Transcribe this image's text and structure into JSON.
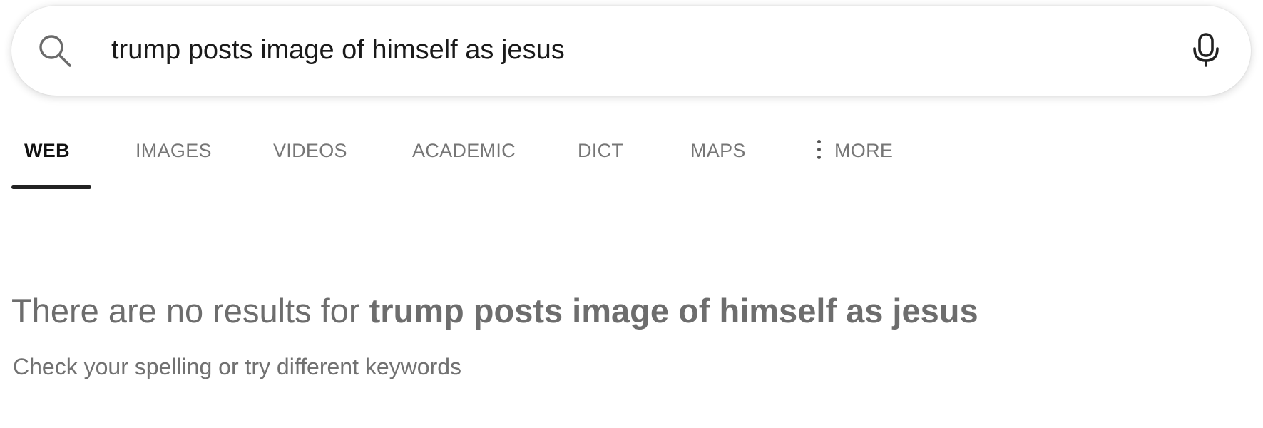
{
  "search": {
    "query": "trump posts image of himself as jesus",
    "search_icon": "search-icon",
    "mic_icon": "microphone-icon"
  },
  "tabs": [
    {
      "label": "WEB",
      "active": true
    },
    {
      "label": "IMAGES",
      "active": false
    },
    {
      "label": "VIDEOS",
      "active": false
    },
    {
      "label": "ACADEMIC",
      "active": false
    },
    {
      "label": "DICT",
      "active": false
    },
    {
      "label": "MAPS",
      "active": false
    },
    {
      "label": "MORE",
      "active": false,
      "icon": "kebab-menu-icon"
    }
  ],
  "results": {
    "no_results_prefix": "There are no results for ",
    "no_results_query": "trump posts image of himself as jesus",
    "hint": "Check your spelling or try different keywords"
  },
  "colors": {
    "active_tab": "#111111",
    "inactive_tab": "#767676",
    "muted_text": "#6d6d6d"
  }
}
